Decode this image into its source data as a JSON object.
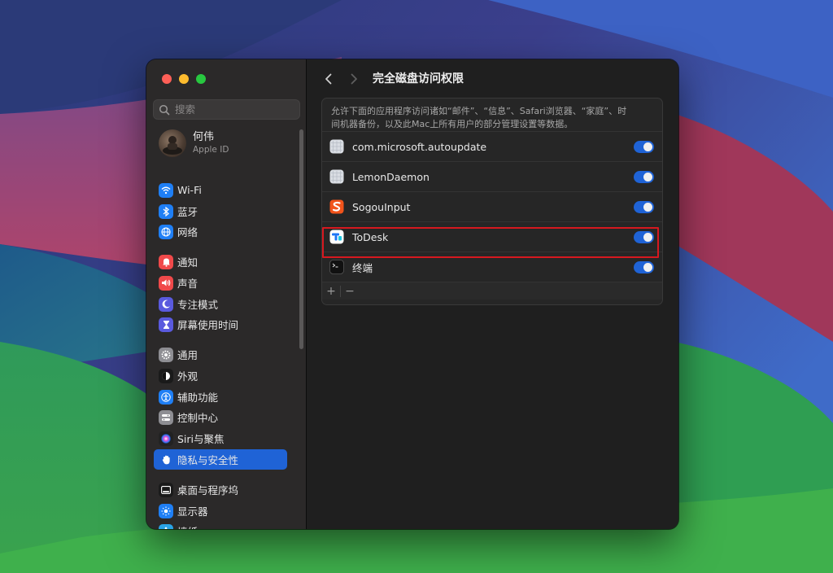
{
  "sidebar": {
    "search_placeholder": "搜索",
    "account": {
      "name": "何伟",
      "subtitle": "Apple ID"
    },
    "items": [
      {
        "label": "Wi-Fi",
        "icon": "wifi-icon",
        "color": "#1f7ff5"
      },
      {
        "label": "蓝牙",
        "icon": "bluetooth-icon",
        "color": "#1f7ff5"
      },
      {
        "label": "网络",
        "icon": "globe-icon",
        "color": "#1f7ff5"
      },
      {
        "label": "通知",
        "icon": "bell-icon",
        "color": "#f0494a"
      },
      {
        "label": "声音",
        "icon": "speaker-icon",
        "color": "#f0494a"
      },
      {
        "label": "专注模式",
        "icon": "moon-icon",
        "color": "#5a5ade"
      },
      {
        "label": "屏幕使用时间",
        "icon": "hourglass-icon",
        "color": "#5a5ade"
      },
      {
        "label": "通用",
        "icon": "gear-icon",
        "color": "#8e8e93"
      },
      {
        "label": "外观",
        "icon": "appearance-icon",
        "color": "#1a1a1a"
      },
      {
        "label": "辅助功能",
        "icon": "accessibility-icon",
        "color": "#1f7ff5"
      },
      {
        "label": "控制中心",
        "icon": "control-center-icon",
        "color": "#8e8e93"
      },
      {
        "label": "Siri与聚焦",
        "icon": "siri-icon",
        "color": "#222222"
      },
      {
        "label": "隐私与安全性",
        "icon": "hand-icon",
        "color": "#1f63d6"
      },
      {
        "label": "桌面与程序坞",
        "icon": "dock-icon",
        "color": "#1a1a1a"
      },
      {
        "label": "显示器",
        "icon": "sun-icon",
        "color": "#1f7ff5"
      },
      {
        "label": "墙纸",
        "icon": "flower-icon",
        "color": "#2aa4e6"
      }
    ],
    "active_index": 12
  },
  "main": {
    "title": "完全磁盘访问权限",
    "description_line1": "允许下面的应用程序访问诸如“邮件”、“信息”、Safari浏览器、“家庭”、时",
    "description_line2": "间机器备份，以及此Mac上所有用户的部分管理设置等数据。",
    "apps": [
      {
        "name": "com.microsoft.autoupdate",
        "icon": "generic-app-icon",
        "enabled": true
      },
      {
        "name": "LemonDaemon",
        "icon": "generic-app-icon",
        "enabled": true
      },
      {
        "name": "SogouInput",
        "icon": "sogou-icon",
        "enabled": true
      },
      {
        "name": "ToDesk",
        "icon": "todesk-icon",
        "enabled": true
      },
      {
        "name": "终端",
        "icon": "terminal-icon",
        "enabled": true
      }
    ],
    "add_label": "+",
    "remove_label": "−"
  },
  "colors": {
    "accent": "#1f63d6",
    "highlight_box": "#d6181f"
  }
}
